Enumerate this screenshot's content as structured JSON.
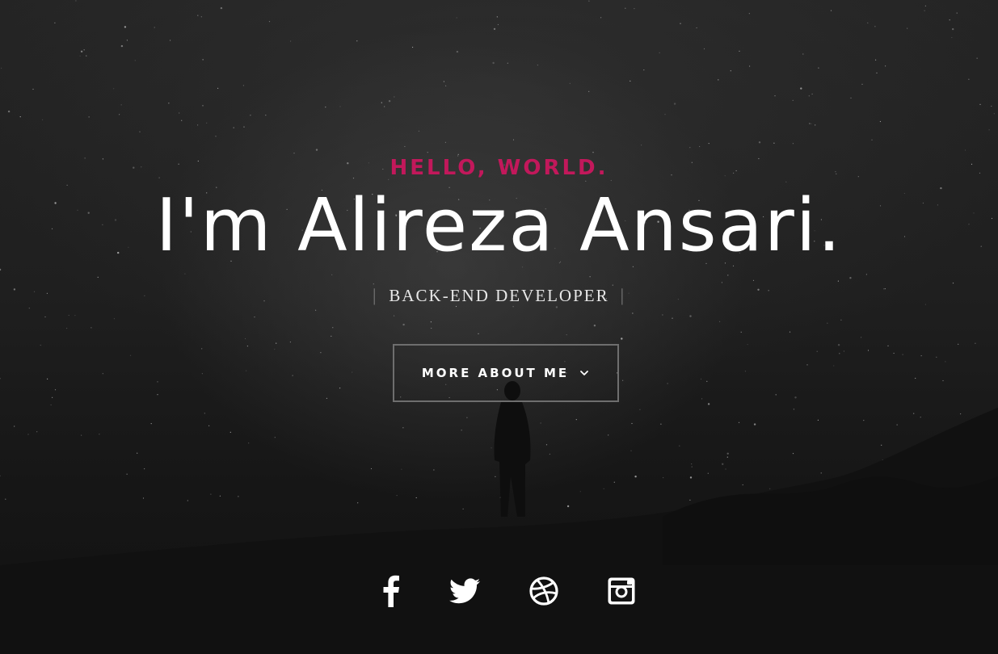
{
  "hero": {
    "greeting": "HELLO, WORLD.",
    "name": "I'm Alireza Ansari.",
    "role": "BACK-END DEVELOPER",
    "role_separator": "|"
  },
  "cta": {
    "label": "MORE ABOUT ME",
    "icon": "chevron-down-icon"
  },
  "social": [
    {
      "icon": "facebook-icon"
    },
    {
      "icon": "twitter-icon"
    },
    {
      "icon": "dribbble-icon"
    },
    {
      "icon": "instagram-icon"
    }
  ],
  "colors": {
    "accent": "#c2185b",
    "text": "#ffffff",
    "background": "#151515",
    "button_border": "#6e6e6e"
  }
}
